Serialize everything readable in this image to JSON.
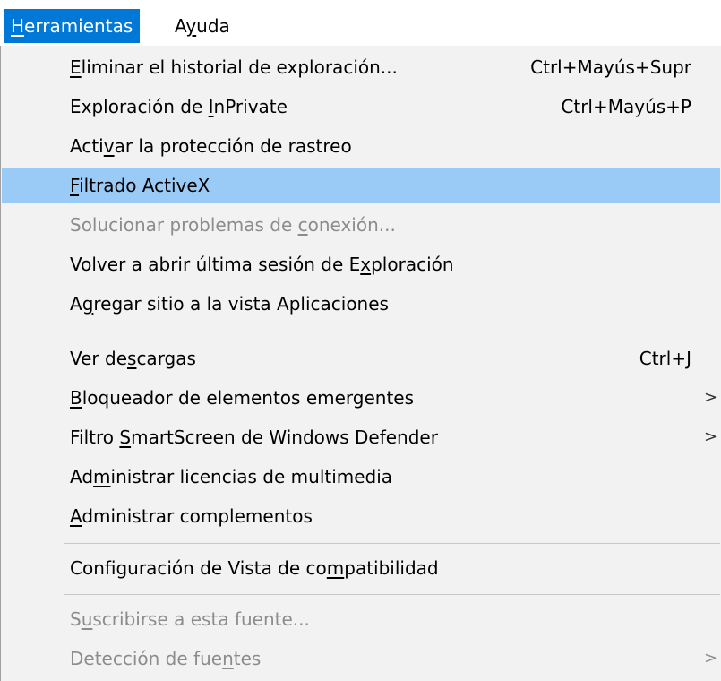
{
  "menubar": {
    "items": [
      {
        "before": "",
        "accel": "H",
        "after": "erramientas"
      },
      {
        "before": "A",
        "accel": "y",
        "after": "uda"
      }
    ]
  },
  "menu": {
    "items": [
      {
        "before": "",
        "accel": "E",
        "after": "liminar el historial de exploración...",
        "shortcut": "Ctrl+Mayús+Supr",
        "disabled": false
      },
      {
        "before": "Exploración de ",
        "accel": "I",
        "after": "nPrivate",
        "shortcut": "Ctrl+Mayús+P",
        "disabled": false
      },
      {
        "before": "Acti",
        "accel": "v",
        "after": "ar la protección de rastreo",
        "shortcut": "",
        "disabled": false
      },
      {
        "before": "",
        "accel": "F",
        "after": "iltrado ActiveX",
        "shortcut": "",
        "disabled": false,
        "highlighted": true
      },
      {
        "before": "Solucionar problemas de ",
        "accel": "c",
        "after": "onexión...",
        "shortcut": "",
        "disabled": true
      },
      {
        "before": "Volver a abrir última sesión de E",
        "accel": "x",
        "after": "ploración",
        "shortcut": "",
        "disabled": false
      },
      {
        "before": "A",
        "accel": "g",
        "after": "regar sitio a la vista Aplicaciones",
        "shortcut": "",
        "disabled": false
      },
      {
        "before": "Ver de",
        "accel": "s",
        "after": "cargas",
        "shortcut": "Ctrl+J",
        "disabled": false
      },
      {
        "before": "",
        "accel": "B",
        "after": "loqueador de elementos emergentes",
        "shortcut": "",
        "submenu": ">",
        "disabled": false
      },
      {
        "before": "Filtro ",
        "accel": "S",
        "after": "martScreen de Windows Defender",
        "shortcut": "",
        "submenu": ">",
        "disabled": false
      },
      {
        "before": "Ad",
        "accel": "m",
        "after": "inistrar licencias de multimedia",
        "shortcut": "",
        "disabled": false
      },
      {
        "before": "",
        "accel": "A",
        "after": "dministrar complementos",
        "shortcut": "",
        "disabled": false
      },
      {
        "before": "Configuración de Vista de co",
        "accel": "m",
        "after": "patibilidad",
        "shortcut": "",
        "disabled": false
      },
      {
        "before": "S",
        "accel": "u",
        "after": "scribirse a esta fuente...",
        "shortcut": "",
        "disabled": true
      },
      {
        "before": "Detección de fue",
        "accel": "n",
        "after": "tes",
        "shortcut": "",
        "submenu": ">",
        "disabled": true
      }
    ]
  },
  "colors": {
    "menubar_active": "#0078d7",
    "menu_background": "#f2f2f2",
    "highlight": "#99cbf6",
    "disabled_text": "#8c8c8c"
  }
}
